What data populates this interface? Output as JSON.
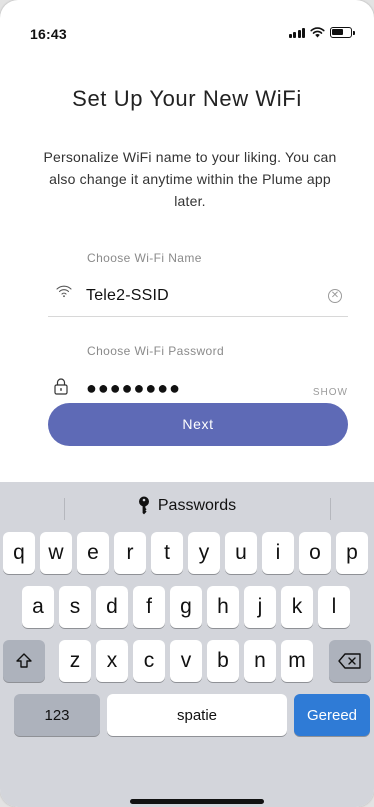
{
  "status_bar": {
    "time": "16:43",
    "icons": [
      "signal-icon",
      "wifi-icon",
      "battery-icon"
    ]
  },
  "main": {
    "title": "Set Up Your New WiFi",
    "subtitle": "Personalize WiFi name to your liking. You can also change it anytime within the Plume app later.",
    "wifi_name_label": "Choose Wi-Fi Name",
    "wifi_name_value": "Tele2-SSID",
    "password_label": "Choose Wi-Fi Password",
    "password_value": "●●●●●●●●",
    "show_label": "SHOW",
    "next_label": "Next",
    "icons": [
      "wifi-icon",
      "clear-icon",
      "lock-icon"
    ],
    "colors": {
      "accent": "#5e6ab6",
      "done_key": "#2f7bd6"
    }
  },
  "keyboard": {
    "suggestion": "Passwords",
    "suggestion_icon": "key-icon",
    "row1": [
      "q",
      "w",
      "e",
      "r",
      "t",
      "y",
      "u",
      "i",
      "o",
      "p"
    ],
    "row2": [
      "a",
      "s",
      "d",
      "f",
      "g",
      "h",
      "j",
      "k",
      "l"
    ],
    "row3": [
      "z",
      "x",
      "c",
      "v",
      "b",
      "n",
      "m"
    ],
    "shift_icon": "shift-icon",
    "backspace_icon": "backspace-icon",
    "numbers_label": "123",
    "space_label": "spatie",
    "done_label": "Gereed"
  }
}
